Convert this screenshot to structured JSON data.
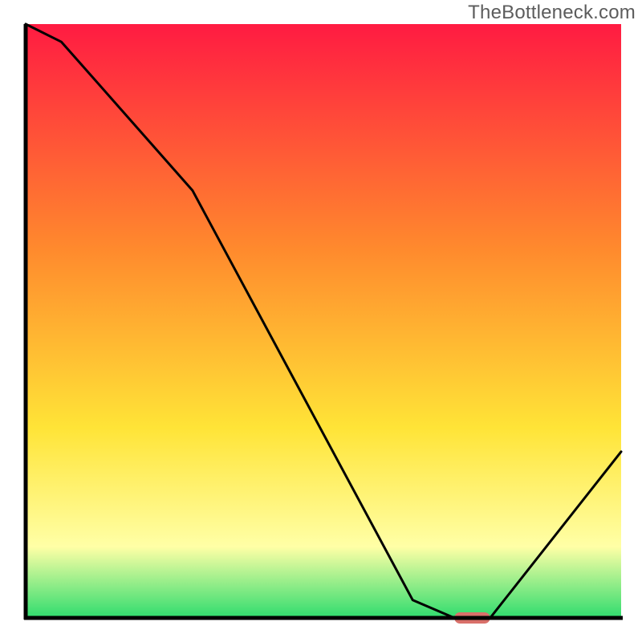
{
  "watermark": "TheBottleneck.com",
  "chart_data": {
    "type": "line",
    "title": "",
    "xlabel": "",
    "ylabel": "",
    "xlim": [
      0,
      100
    ],
    "ylim": [
      0,
      100
    ],
    "series": [
      {
        "name": "bottleneck-curve",
        "x": [
          0,
          6,
          28,
          65,
          72,
          78,
          100
        ],
        "y": [
          100,
          97,
          72,
          3,
          0,
          0,
          28
        ]
      }
    ],
    "marker": {
      "name": "selected-point",
      "x": 75,
      "y": 0,
      "color": "#d9706a",
      "width_pct": 6
    },
    "background_gradient": {
      "top": "#ff1b42",
      "mid1": "#ff8a2d",
      "mid2": "#ffe437",
      "low": "#ffffa6",
      "bottom": "#2fdc6e"
    }
  }
}
